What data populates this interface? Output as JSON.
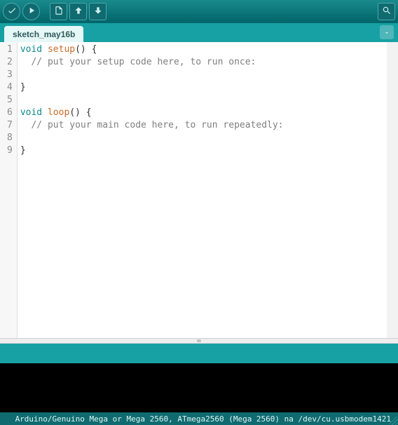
{
  "tab": {
    "name": "sketch_may16b"
  },
  "code": {
    "lines": [
      {
        "n": 1,
        "tokens": [
          {
            "t": "void",
            "c": "kw"
          },
          {
            "t": " ",
            "c": ""
          },
          {
            "t": "setup",
            "c": "fn"
          },
          {
            "t": "() {",
            "c": "pn"
          }
        ]
      },
      {
        "n": 2,
        "tokens": [
          {
            "t": "  // put your setup code here, to run once:",
            "c": "cm"
          }
        ]
      },
      {
        "n": 3,
        "tokens": []
      },
      {
        "n": 4,
        "tokens": [
          {
            "t": "}",
            "c": "pn"
          }
        ]
      },
      {
        "n": 5,
        "tokens": []
      },
      {
        "n": 6,
        "tokens": [
          {
            "t": "void",
            "c": "kw"
          },
          {
            "t": " ",
            "c": ""
          },
          {
            "t": "loop",
            "c": "fn"
          },
          {
            "t": "() {",
            "c": "pn"
          }
        ]
      },
      {
        "n": 7,
        "tokens": [
          {
            "t": "  // put your main code here, to run repeatedly:",
            "c": "cm"
          }
        ]
      },
      {
        "n": 8,
        "tokens": []
      },
      {
        "n": 9,
        "tokens": [
          {
            "t": "}",
            "c": "pn"
          }
        ]
      }
    ]
  },
  "status": {
    "text": "Arduino/Genuino Mega or Mega 2560, ATmega2560 (Mega 2560) na /dev/cu.usbmodem1421"
  }
}
